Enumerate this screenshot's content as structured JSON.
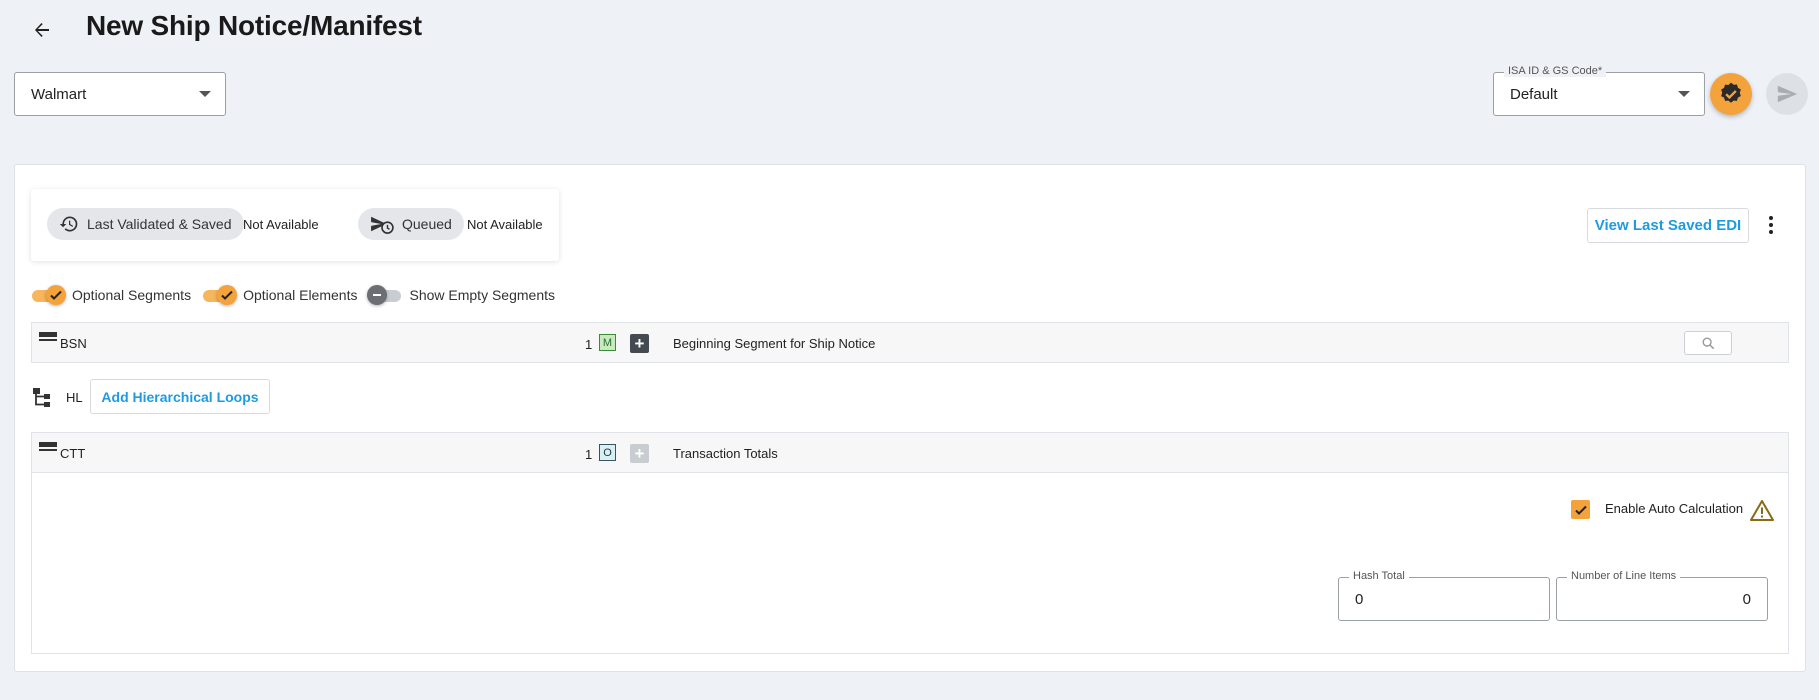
{
  "header": {
    "title": "New Ship Notice/Manifest"
  },
  "partner_select": {
    "value": "Walmart"
  },
  "isa_select": {
    "label": "ISA ID & GS Code*",
    "value": "Default"
  },
  "status": {
    "validated_label": "Last Validated & Saved",
    "validated_value": "Not Available",
    "queued_label": "Queued",
    "queued_value": "Not Available"
  },
  "actions": {
    "view_edi_label": "View Last Saved EDI"
  },
  "toggles": {
    "optional_segments": "Optional Segments",
    "optional_elements": "Optional Elements",
    "show_empty_segments": "Show Empty Segments"
  },
  "segments": {
    "bsn": {
      "code": "BSN",
      "count": "1",
      "badge": "M",
      "desc": "Beginning Segment for Ship Notice"
    },
    "ctt": {
      "code": "CTT",
      "count": "1",
      "badge": "O",
      "desc": "Transaction Totals"
    }
  },
  "hl": {
    "label": "HL",
    "button": "Add Hierarchical Loops"
  },
  "ctt_body": {
    "auto_calc_label": "Enable Auto Calculation",
    "hash_total_label": "Hash Total",
    "hash_total_value": "0",
    "line_items_label": "Number of Line Items",
    "line_items_value": "0"
  },
  "colors": {
    "accent": "#f4a23b",
    "link": "#1e9be0",
    "background": "#eef2f6"
  },
  "icons": {
    "back": "arrow-left-icon",
    "validate": "verified-badge-icon",
    "send": "send-icon",
    "history": "history-icon",
    "queued": "plane-clock-icon",
    "segment": "segment-lines-icon",
    "tree": "hierarchy-tree-icon",
    "search": "search-icon",
    "warning": "warning-icon"
  }
}
